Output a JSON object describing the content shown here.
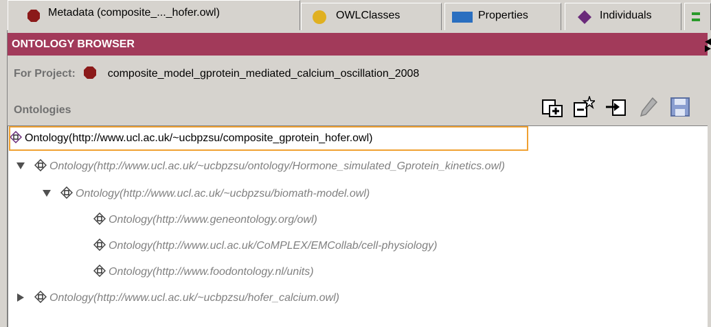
{
  "tabs": [
    {
      "label": "Metadata (composite_..._hofer.owl)",
      "icon": "dark-red-octagon-icon",
      "active": true
    },
    {
      "label": "OWLClasses",
      "icon": "gold-circle-icon",
      "active": false
    },
    {
      "label": "Properties",
      "icon": "blue-rectangle-icon",
      "active": false
    },
    {
      "label": "Individuals",
      "icon": "purple-diamond-icon",
      "active": false
    }
  ],
  "header": {
    "title": "ONTOLOGY BROWSER"
  },
  "project": {
    "label": "For Project:",
    "name": "composite_model_gprotein_mediated_calcium_oscillation_2008"
  },
  "ontologies_label": "Ontologies",
  "toolbar": [
    "create-ontology-icon",
    "new-ontology-icon",
    "import-ontology-icon",
    "edit-pencil-icon",
    "save-disk-icon"
  ],
  "tree": [
    {
      "text": "Ontology(http://www.ucl.ac.uk/~ucbpzsu/composite_gprotein_hofer.owl)",
      "depth": 0,
      "toggle": "none",
      "selected": true,
      "italic": false
    },
    {
      "text": "Ontology(http://www.ucl.ac.uk/~ucbpzsu/ontology/Hormone_simulated_Gprotein_kinetics.owl)",
      "depth": 0,
      "toggle": "expanded",
      "italic": true
    },
    {
      "text": "Ontology(http://www.ucl.ac.uk/~ucbpzsu/biomath-model.owl)",
      "depth": 1,
      "toggle": "expanded",
      "italic": true
    },
    {
      "text": "Ontology(http://www.geneontology.org/owl)",
      "depth": 2,
      "toggle": "none",
      "italic": true
    },
    {
      "text": "Ontology(http://www.ucl.ac.uk/CoMPLEX/EMCollab/cell-physiology)",
      "depth": 2,
      "toggle": "none",
      "italic": true
    },
    {
      "text": "Ontology(http://www.foodontology.nl/units)",
      "depth": 2,
      "toggle": "none",
      "italic": true
    },
    {
      "text": "Ontology(http://www.ucl.ac.uk/~ucbpzsu/hofer_calcium.owl)",
      "depth": 0,
      "toggle": "collapsed",
      "italic": true
    }
  ],
  "colors": {
    "header": "#a23a5a",
    "metadata": "#8b1a1a",
    "owlclasses": "#e0b020",
    "properties": "#2a6fc0",
    "individuals": "#6a2a7a",
    "selection": "#f0a030"
  }
}
